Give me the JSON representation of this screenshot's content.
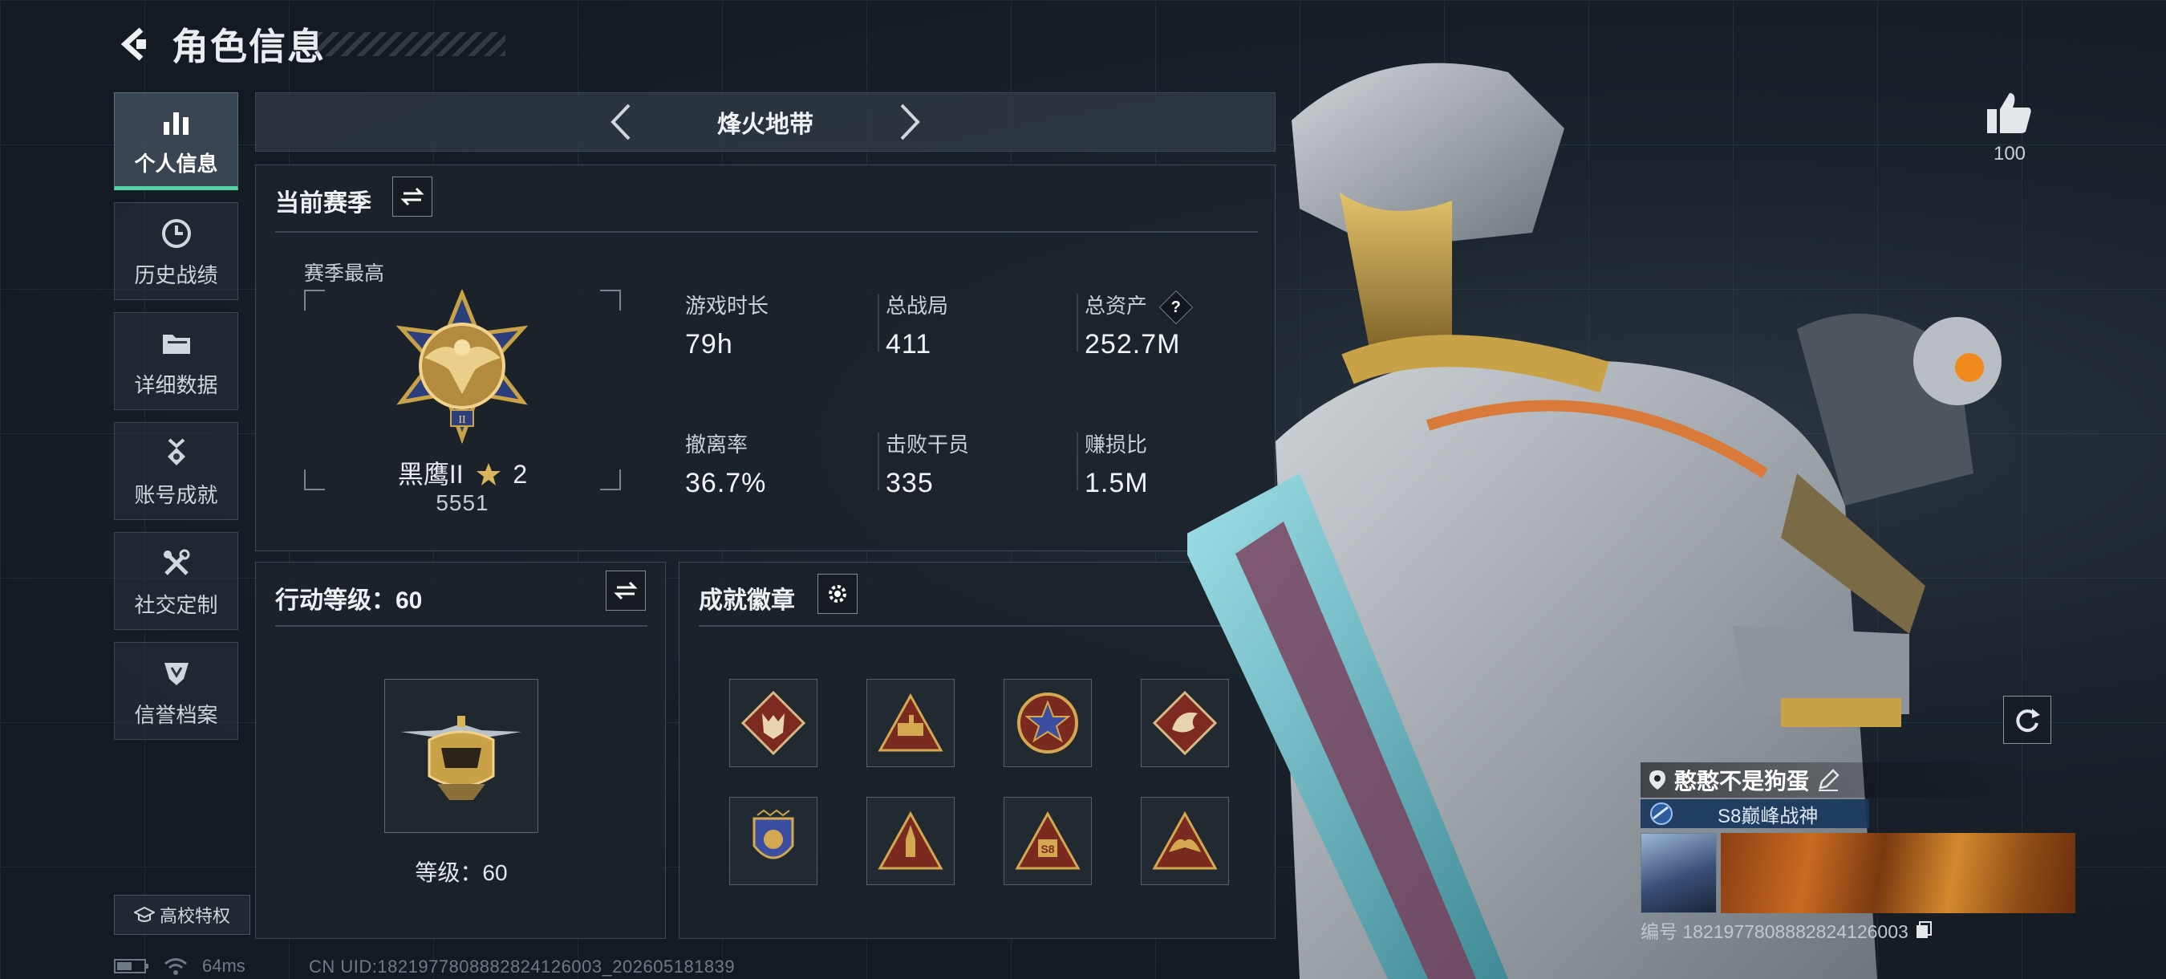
{
  "header": {
    "title": "角色信息"
  },
  "sidebar": {
    "items": [
      {
        "label": "个人信息",
        "icon": "bar-chart-icon",
        "active": true
      },
      {
        "label": "历史战绩",
        "icon": "history-clock-icon",
        "active": false
      },
      {
        "label": "详细数据",
        "icon": "folder-icon",
        "active": false
      },
      {
        "label": "账号成就",
        "icon": "medal-ribbon-icon",
        "active": false
      },
      {
        "label": "社交定制",
        "icon": "tools-icon",
        "active": false
      },
      {
        "label": "信誉档案",
        "icon": "shield-badge-icon",
        "active": false
      }
    ],
    "school_label": "高校特权"
  },
  "mode": {
    "name": "烽火地带"
  },
  "season": {
    "title": "当前赛季",
    "best_label": "赛季最高",
    "rank_name": "黑鹰II",
    "rank_stars": "2",
    "rank_score": "5551",
    "stats": [
      {
        "label": "游戏时长",
        "value": "79h"
      },
      {
        "label": "总战局",
        "value": "411"
      },
      {
        "label": "总资产",
        "value": "252.7M",
        "help": "?"
      },
      {
        "label": "撤离率",
        "value": "36.7%"
      },
      {
        "label": "击败干员",
        "value": "335"
      },
      {
        "label": "赚损比",
        "value": "1.5M"
      }
    ]
  },
  "level": {
    "title": "行动等级：60",
    "level_text": "等级：60"
  },
  "badges": {
    "title": "成就徽章",
    "items": [
      "wolf-badge-icon",
      "tank-badge-icon",
      "star-emblem-badge-icon",
      "dragon-badge-icon",
      "shield-wings-badge-icon",
      "rocket-badge-icon",
      "s8-badge-icon",
      "eagle-badge-icon"
    ]
  },
  "likes": {
    "count": "100"
  },
  "player": {
    "name": "憨憨不是狗蛋",
    "title_tag": "S8巅峰战神",
    "id_text": "编号 1821977808882824126003"
  },
  "status": {
    "ping": "64ms",
    "uid": "CN UID:1821977808882824126003_202605181839"
  },
  "colors": {
    "accent_green": "#4fd4a5",
    "panel_bg": "#1c232b",
    "tag_blue": "#16345a",
    "gold": "#c9a247"
  }
}
